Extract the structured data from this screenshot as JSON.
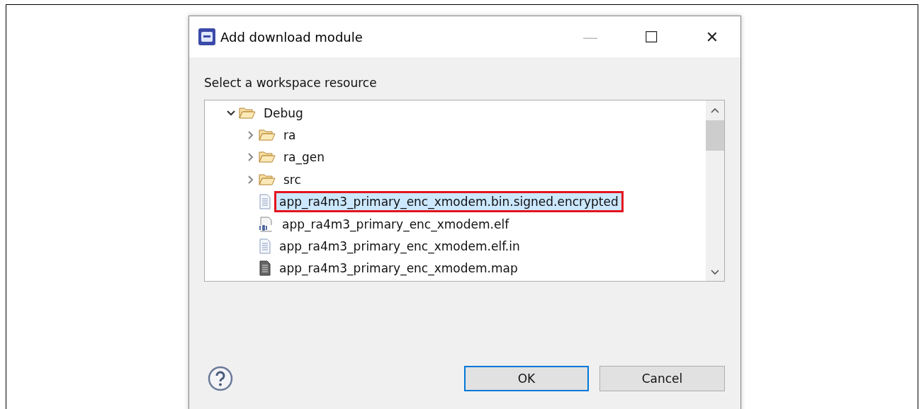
{
  "window": {
    "title": "Add download module",
    "controls": [
      "—",
      "☐",
      "✕"
    ]
  },
  "prompt": "Select a workspace resource",
  "tree": [
    {
      "label": "Debug",
      "kind": "folder",
      "expanded": true,
      "selected": false,
      "highlighted": false,
      "children": [
        {
          "label": "ra",
          "kind": "folder",
          "expanded": false,
          "selected": false,
          "highlighted": false
        },
        {
          "label": "ra_gen",
          "kind": "folder",
          "expanded": false,
          "selected": false,
          "highlighted": false
        },
        {
          "label": "src",
          "kind": "folder",
          "expanded": false,
          "selected": false,
          "highlighted": false
        },
        {
          "label": "app_ra4m3_primary_enc_xmodem.bin.signed.encrypted",
          "kind": "text",
          "selected": true,
          "highlighted": true
        },
        {
          "label": "app_ra4m3_primary_enc_xmodem.elf",
          "kind": "binary",
          "selected": false,
          "highlighted": false
        },
        {
          "label": "app_ra4m3_primary_enc_xmodem.elf.in",
          "kind": "text",
          "selected": false,
          "highlighted": false
        },
        {
          "label": "app_ra4m3_primary_enc_xmodem.map",
          "kind": "document",
          "selected": false,
          "highlighted": false
        }
      ]
    }
  ],
  "buttons": [
    {
      "label": "OK",
      "default": true
    },
    {
      "label": "Cancel",
      "default": false
    }
  ]
}
